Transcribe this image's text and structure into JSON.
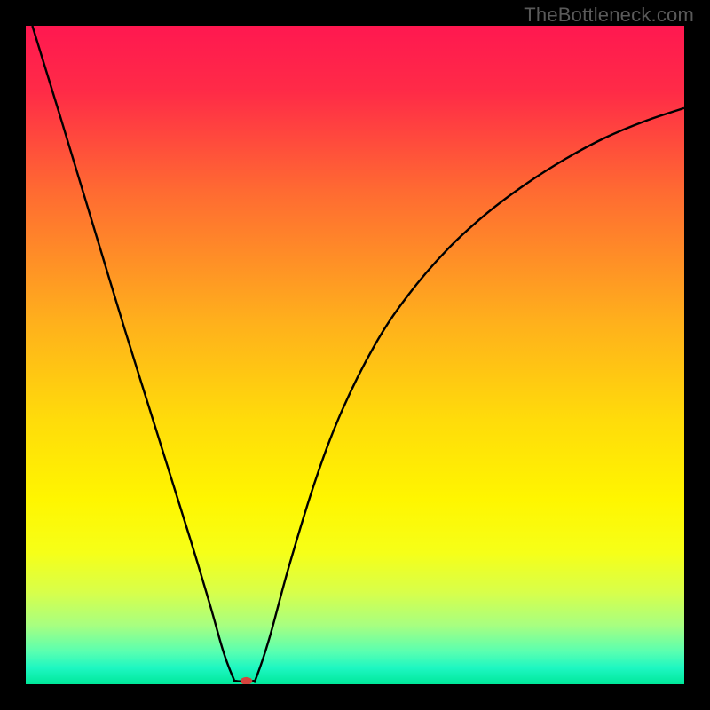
{
  "watermark": "TheBottleneck.com",
  "chart_data": {
    "type": "line",
    "title": "",
    "xlabel": "",
    "ylabel": "",
    "xlim": [
      0,
      100
    ],
    "ylim": [
      0,
      100
    ],
    "background_gradient": {
      "stops": [
        {
          "offset": 0.0,
          "color": "#ff1850"
        },
        {
          "offset": 0.1,
          "color": "#ff2b47"
        },
        {
          "offset": 0.25,
          "color": "#ff6a32"
        },
        {
          "offset": 0.45,
          "color": "#ffb01c"
        },
        {
          "offset": 0.6,
          "color": "#ffdc0a"
        },
        {
          "offset": 0.72,
          "color": "#fff600"
        },
        {
          "offset": 0.8,
          "color": "#f6ff18"
        },
        {
          "offset": 0.86,
          "color": "#d8ff4a"
        },
        {
          "offset": 0.91,
          "color": "#a8ff80"
        },
        {
          "offset": 0.95,
          "color": "#5affb0"
        },
        {
          "offset": 0.975,
          "color": "#1ef7c2"
        },
        {
          "offset": 1.0,
          "color": "#00e89a"
        }
      ]
    },
    "series": [
      {
        "name": "curve",
        "color": "#000000",
        "stroke_width": 2.4,
        "points": [
          {
            "x": 1.0,
            "y": 100.0
          },
          {
            "x": 5.0,
            "y": 87.0
          },
          {
            "x": 10.0,
            "y": 70.5
          },
          {
            "x": 15.0,
            "y": 54.0
          },
          {
            "x": 20.0,
            "y": 38.0
          },
          {
            "x": 25.0,
            "y": 22.0
          },
          {
            "x": 28.0,
            "y": 12.0
          },
          {
            "x": 30.0,
            "y": 5.0
          },
          {
            "x": 31.5,
            "y": 1.0
          },
          {
            "x": 32.0,
            "y": 0.5
          },
          {
            "x": 34.5,
            "y": 0.5
          },
          {
            "x": 35.0,
            "y": 1.0
          },
          {
            "x": 37.0,
            "y": 7.0
          },
          {
            "x": 40.0,
            "y": 18.0
          },
          {
            "x": 44.0,
            "y": 31.0
          },
          {
            "x": 48.0,
            "y": 41.5
          },
          {
            "x": 53.0,
            "y": 51.5
          },
          {
            "x": 58.0,
            "y": 59.0
          },
          {
            "x": 64.0,
            "y": 66.0
          },
          {
            "x": 70.0,
            "y": 71.5
          },
          {
            "x": 76.0,
            "y": 76.0
          },
          {
            "x": 82.0,
            "y": 79.8
          },
          {
            "x": 88.0,
            "y": 83.0
          },
          {
            "x": 94.0,
            "y": 85.5
          },
          {
            "x": 100.0,
            "y": 87.5
          }
        ]
      }
    ],
    "marker": {
      "name": "optimal-point",
      "x": 33.5,
      "y": 0.5,
      "rx": 0.9,
      "ry": 0.6,
      "color": "#d6443e"
    }
  }
}
